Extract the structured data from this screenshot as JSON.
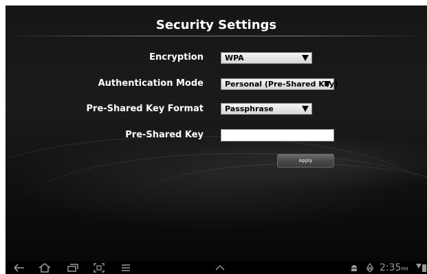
{
  "page": {
    "title": "Security Settings"
  },
  "form": {
    "encryption": {
      "label": "Encryption",
      "value": "WPA"
    },
    "authentication_mode": {
      "label": "Authentication Mode",
      "value": "Personal (Pre-Shared Key)"
    },
    "psk_format": {
      "label": "Pre-Shared Key Format",
      "value": "Passphrase"
    },
    "psk": {
      "label": "Pre-Shared Key",
      "value": ""
    },
    "apply_label": "Apply"
  },
  "system_bar": {
    "time": "2:35",
    "ampm": "PM",
    "icons": [
      "back-icon",
      "home-icon",
      "recent-apps-icon",
      "screenshot-icon",
      "menu-icon",
      "chevron-up-icon",
      "android-icon",
      "recycle-icon",
      "signal-icon",
      "battery-icon"
    ]
  },
  "colors": {
    "background": "#0c0c0c",
    "text": "#ffffff",
    "select_bg": "#e6e6e6",
    "button_bg": "#4a4a4a"
  }
}
